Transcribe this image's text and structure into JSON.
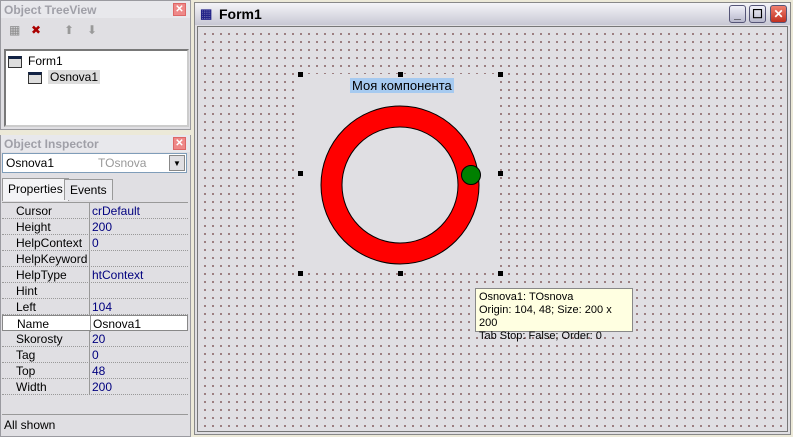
{
  "treeview": {
    "title": "Object TreeView",
    "nodes": [
      "Form1",
      "Osnova1"
    ]
  },
  "inspector": {
    "title": "Object Inspector",
    "object": "Osnova1",
    "class": "TOsnova",
    "tabs": [
      "Properties",
      "Events"
    ],
    "props": [
      [
        "Cursor",
        "crDefault"
      ],
      [
        "Height",
        "200"
      ],
      [
        "HelpContext",
        "0"
      ],
      [
        "HelpKeyword",
        ""
      ],
      [
        "HelpType",
        "htContext"
      ],
      [
        "Hint",
        ""
      ],
      [
        "Left",
        "104"
      ],
      [
        "Name",
        "Osnova1"
      ],
      [
        "Skorosty",
        "20"
      ],
      [
        "Tag",
        "0"
      ],
      [
        "Top",
        "48"
      ],
      [
        "Width",
        "200"
      ]
    ],
    "status": "All shown"
  },
  "form": {
    "title": "Form1",
    "component_caption": "Моя компонента",
    "tooltip": [
      "Osnova1: TOsnova",
      "Origin: 104, 48; Size: 200 x 200",
      "Tab Stop: False; Order: 0"
    ]
  },
  "colors": {
    "ring": "#ff0000",
    "dot": "#008000"
  }
}
